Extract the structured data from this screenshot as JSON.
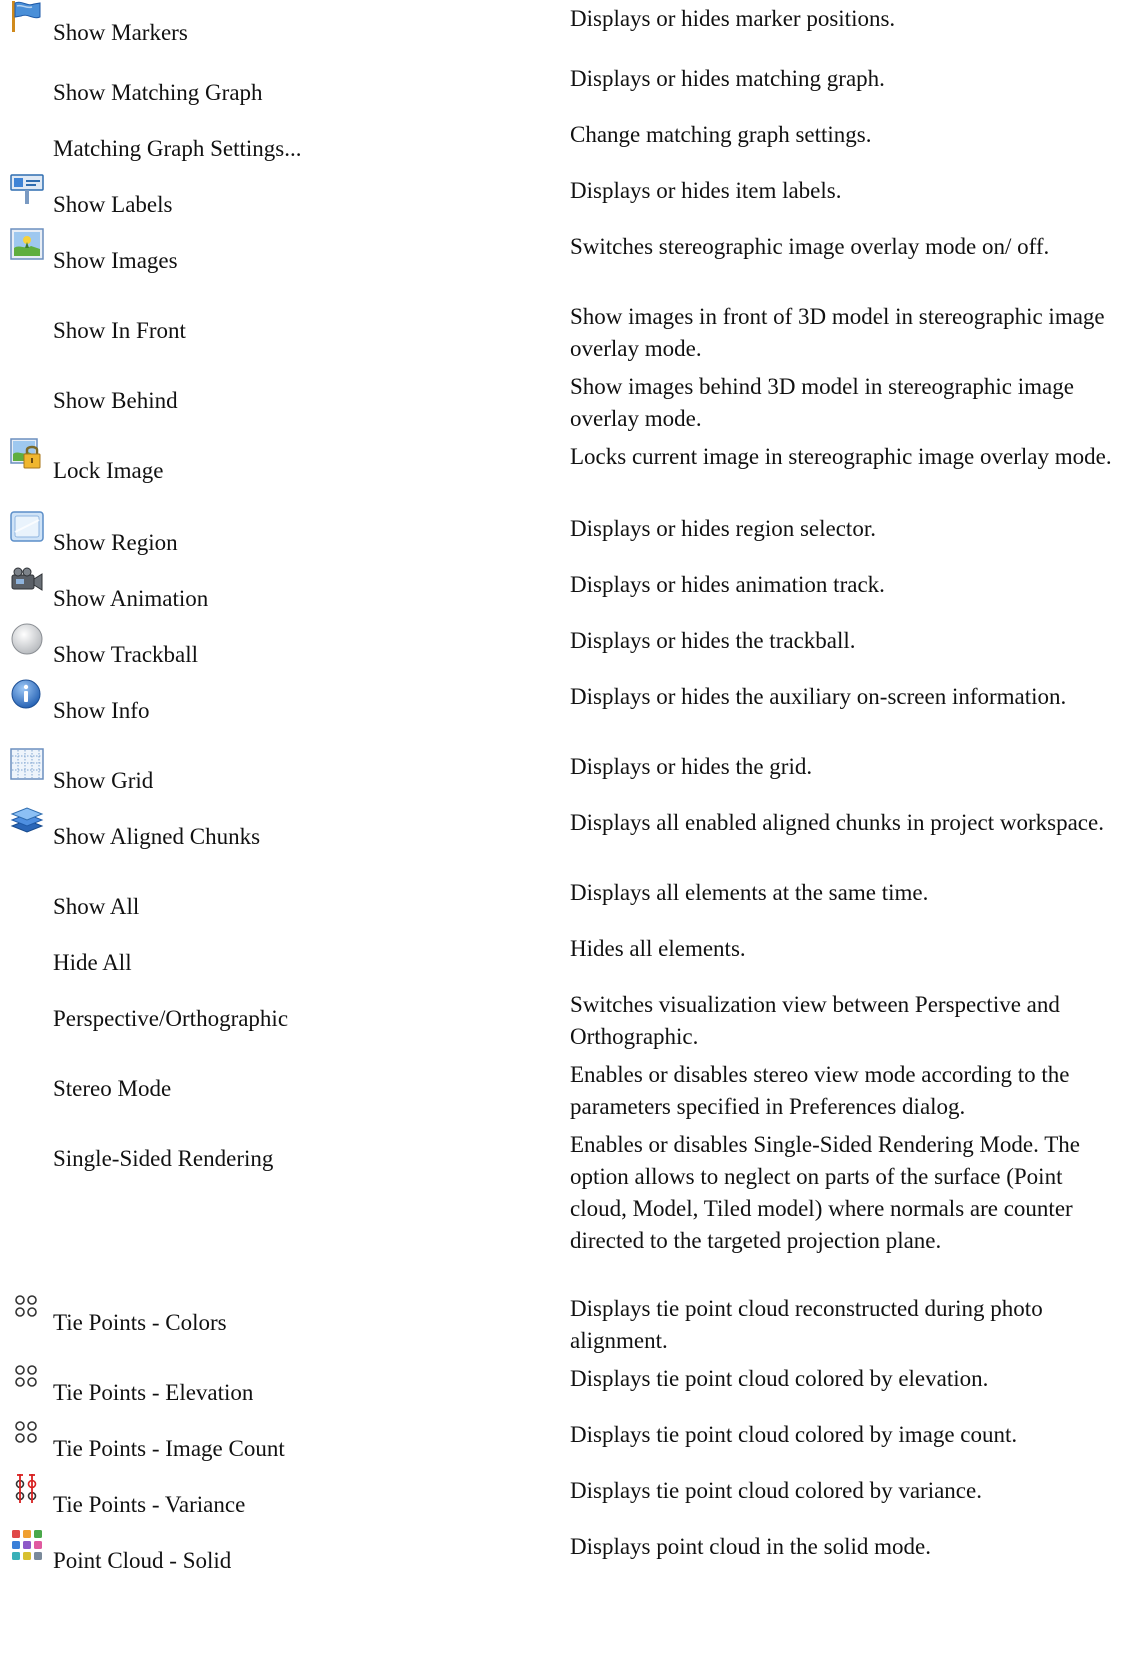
{
  "rows": [
    {
      "icon": "flag-icon",
      "label": "Show Markers",
      "description": "Displays or hides marker positions."
    },
    {
      "icon": "",
      "label": "Show Matching Graph",
      "description": "Displays or hides matching graph."
    },
    {
      "icon": "",
      "label": "Matching Graph Settings...",
      "description": "Change matching graph settings."
    },
    {
      "icon": "labels-icon",
      "label": "Show Labels",
      "description": "Displays or hides item labels."
    },
    {
      "icon": "image-icon",
      "label": "Show Images",
      "description": "Switches stereographic image overlay mode on/ off."
    },
    {
      "icon": "",
      "label": "Show In Front",
      "description": "Show images in front of 3D model in stereographic image overlay mode."
    },
    {
      "icon": "",
      "label": "Show Behind",
      "description": "Show images behind 3D model in stereographic image overlay mode."
    },
    {
      "icon": "lock-image-icon",
      "label": "Lock Image",
      "description": "Locks current image in stereographic image overlay mode."
    },
    {
      "icon": "region-icon",
      "label": "Show Region",
      "description": "Displays or hides region selector."
    },
    {
      "icon": "camera-track-icon",
      "label": "Show Animation",
      "description": "Displays or hides animation track."
    },
    {
      "icon": "trackball-icon",
      "label": "Show Trackball",
      "description": "Displays or hides the trackball."
    },
    {
      "icon": "info-icon",
      "label": "Show Info",
      "description": "Displays or hides the auxiliary on-screen information."
    },
    {
      "icon": "grid-icon",
      "label": "Show Grid",
      "description": "Displays or hides the grid."
    },
    {
      "icon": "aligned-chunks-icon",
      "label": "Show Aligned Chunks",
      "description": "Displays all enabled aligned chunks in project workspace."
    },
    {
      "icon": "",
      "label": "Show All",
      "description": "Displays all elements at the same time."
    },
    {
      "icon": "",
      "label": "Hide All",
      "description": "Hides all elements."
    },
    {
      "icon": "",
      "label": "Perspective/Orthographic",
      "description": "Switches visualization view between Perspective and Orthographic."
    },
    {
      "icon": "",
      "label": "Stereo Mode",
      "description": "Enables or disables stereo view mode according to the parameters specified in Preferences dialog."
    },
    {
      "icon": "",
      "label": "Single-Sided Rendering",
      "description": "Enables or disables Single-Sided Rendering Mode. The option allows to neglect on parts of the surface (Point cloud, Model, Tiled model) where normals are counter directed to the targeted projection plane."
    },
    {
      "icon": "tie-points-icon",
      "label": "Tie Points - Colors",
      "description": "Displays tie point cloud reconstructed during photo alignment."
    },
    {
      "icon": "tie-points-icon",
      "label": "Tie Points - Elevation",
      "description": "Displays tie point cloud colored by elevation."
    },
    {
      "icon": "tie-points-icon",
      "label": "Tie Points - Image Count",
      "description": "Displays tie point cloud colored by image count."
    },
    {
      "icon": "tie-points-variance-icon",
      "label": "Tie Points - Variance",
      "description": "Displays tie point cloud colored by variance."
    },
    {
      "icon": "point-cloud-solid-icon",
      "label": "Point Cloud - Solid",
      "description": "Displays point cloud in the solid mode."
    }
  ]
}
